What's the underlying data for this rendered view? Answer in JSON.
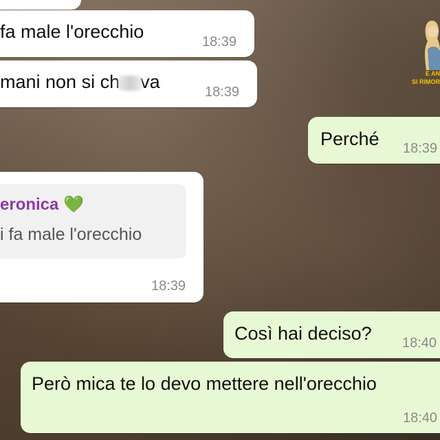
{
  "messages": [
    {
      "side": "in",
      "text": "fa male l'orecchio",
      "time": "18:39"
    },
    {
      "side": "in",
      "text_before": "mani non si ch",
      "text_after": "va",
      "time": "18:39"
    },
    {
      "side": "out",
      "text": "Perché",
      "time": "18:39"
    },
    {
      "side": "in",
      "quote_name": "eronica 💚",
      "quote_text": "i fa male l'orecchio",
      "text": "",
      "time": "18:39"
    },
    {
      "side": "out",
      "text": "Così hai deciso?",
      "time": "18:40"
    },
    {
      "side": "out",
      "text": "Però mica te lo devo mettere nell'orecchio",
      "time": "18:40"
    }
  ],
  "logo": {
    "line1": "E AN",
    "line2": "SI RIMOR"
  },
  "colors": {
    "incoming_bubble": "#ffffff",
    "outgoing_bubble": "#e7f9d4",
    "quote_name": "#8e3ba8",
    "timestamp": "#8a8a8a"
  }
}
